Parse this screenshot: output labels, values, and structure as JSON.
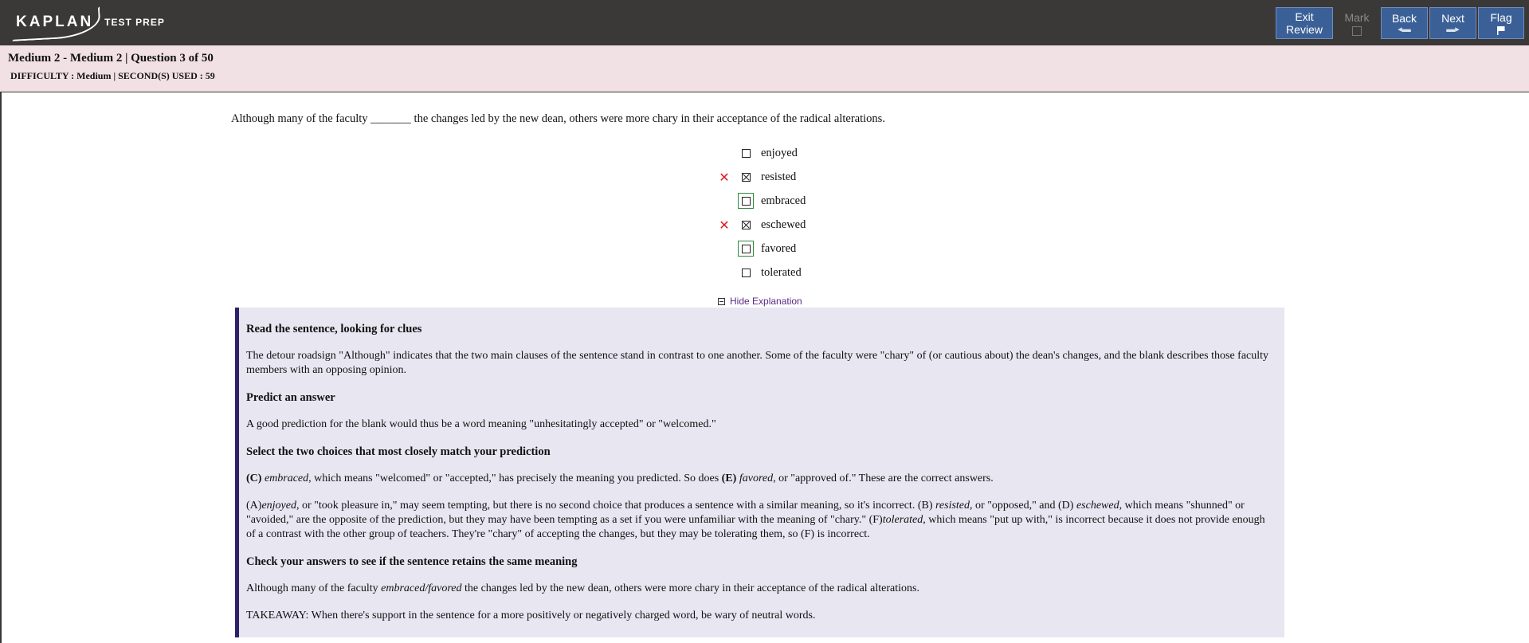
{
  "app": {
    "logo_text": "KAPLAN",
    "logo_subtext": "TEST PREP"
  },
  "toolbar": {
    "exit_review_line1": "Exit",
    "exit_review_line2": "Review",
    "mark_label": "Mark",
    "back_label": "Back",
    "next_label": "Next",
    "flag_label": "Flag",
    "accent_color": "#3b6097",
    "bar_color": "#3b3838"
  },
  "header": {
    "title": "Medium 2 - Medium 2 | Question 3 of 50",
    "meta": "DIFFICULTY : Medium | SECOND(S) USED : 59",
    "background": "#f2e1e4"
  },
  "question": {
    "stem": "Although many of the faculty _______ the changes led by the new dean, others were more chary in their acceptance of the radical alterations.",
    "choices": [
      {
        "label": "enjoyed",
        "checked": false,
        "wrong": false,
        "correct": false
      },
      {
        "label": "resisted",
        "checked": true,
        "wrong": true,
        "correct": false
      },
      {
        "label": "embraced",
        "checked": false,
        "wrong": false,
        "correct": true
      },
      {
        "label": "eschewed",
        "checked": true,
        "wrong": true,
        "correct": false
      },
      {
        "label": "favored",
        "checked": false,
        "wrong": false,
        "correct": true
      },
      {
        "label": "tolerated",
        "checked": false,
        "wrong": false,
        "correct": false
      }
    ],
    "wrong_mark": "✕"
  },
  "explanation": {
    "toggle_label": "Hide Explanation",
    "h1": "Read the sentence, looking for clues",
    "p1": "The detour roadsign \"Although\" indicates that the two main clauses of the sentence stand in contrast to one another. Some of the faculty were \"chary\" of (or cautious about) the dean's changes, and the blank describes those faculty members with an opposing opinion.",
    "h2": "Predict an answer",
    "p2": "A good prediction for the blank would thus be a word meaning \"unhesitatingly accepted\" or \"welcomed.\"",
    "h3": "Select the two choices that most closely match your prediction",
    "p3": {
      "c_label": "(C)",
      "c_word": "embraced",
      "mid": ", which means \"welcomed\" or \"accepted,\" has precisely the meaning you predicted. So does",
      "e_label": "(E)",
      "e_word": "favored",
      "end": ", or \"approved of.\" These are the correct answers."
    },
    "p4": {
      "a_label": "(A)",
      "a_word": "enjoyed",
      "a_text": ", or \"took pleasure in,\" may seem tempting, but there is no second choice that produces a sentence with a similar meaning, so it's incorrect. (B)",
      "b_word": "resisted",
      "b_text": ", or \"opposed,\" and (D)",
      "d_word": "eschewed",
      "d_text": ", which means \"shunned\" or \"avoided,\" are the opposite of the prediction, but they may have been tempting as a set if you were unfamiliar with the meaning of \"chary.\" (F)",
      "f_word": "tolerated",
      "f_text": ", which means \"put up with,\" is incorrect because it does not provide enough of a contrast with the other group of teachers. They're \"chary\" of accepting the changes, but they may be tolerating them, so (F) is incorrect."
    },
    "h4": "Check your answers to see if the sentence retains the same meaning",
    "p5": {
      "start": "Although many of the faculty",
      "words": "embraced/favored",
      "end": "the changes led by the new dean, others were more chary in their acceptance of the radical alterations."
    },
    "p6": "TAKEAWAY: When there's support in the sentence for a more positively or negatively charged word, be wary of neutral words.",
    "panel_color": "#e7e6f1",
    "rule_color": "#2e2166"
  }
}
